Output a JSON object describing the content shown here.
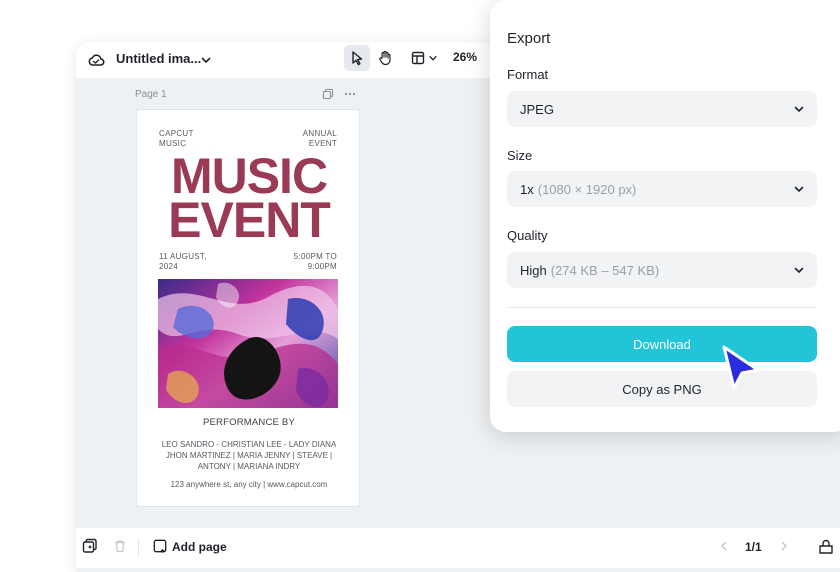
{
  "editor": {
    "doc_title": "Untitled ima...",
    "zoom": "26%",
    "page_label": "Page 1",
    "add_page_label": "Add page",
    "pagination": "1/1"
  },
  "poster": {
    "top_left": [
      "CAPCUT",
      "MUSIC"
    ],
    "top_right": [
      "ANNUAL",
      "EVENT"
    ],
    "headline": [
      "MUSIC",
      "EVENT"
    ],
    "date": [
      "11 AUGUST,",
      "2024"
    ],
    "time": [
      "5:00PM TO",
      "9:00PM"
    ],
    "performance_label": "PERFORMANCE BY",
    "performers": [
      "LEO SANDRO - CHRISTIAN LEE - LADY DIANA",
      "JHON MARTINEZ | MARIA JENNY | STEAVE |",
      "ANTONY | MARIANA INDRY"
    ],
    "address": "123 anywhere st, any city | www.capcut.com",
    "headline_color": "#9a3a55"
  },
  "export": {
    "title": "Export",
    "format": {
      "label": "Format",
      "value": "JPEG"
    },
    "size": {
      "label": "Size",
      "value": "1x",
      "detail": "(1080 × 1920 px)"
    },
    "quality": {
      "label": "Quality",
      "value": "High",
      "detail": "(274 KB – 547 KB)"
    },
    "download_label": "Download",
    "copy_label": "Copy as PNG",
    "accent_color": "#22c4d8"
  },
  "cursor_color": "#2b2bdf"
}
